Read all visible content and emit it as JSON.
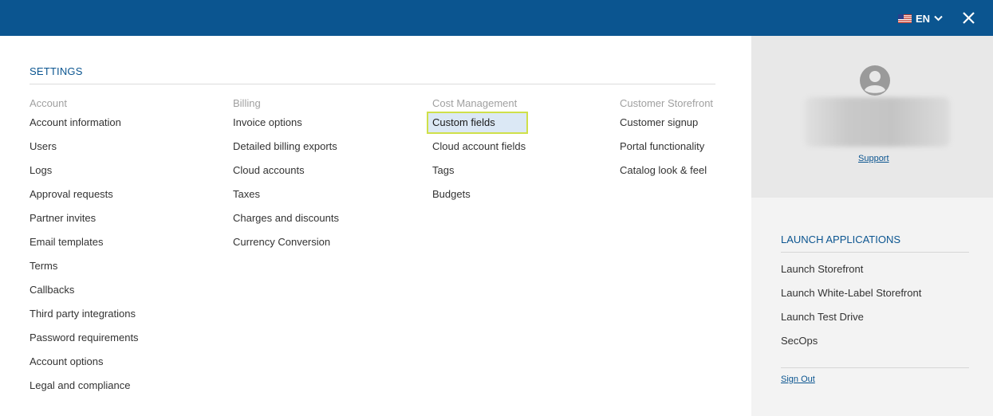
{
  "header": {
    "language_code": "EN",
    "flag_icon": "us-flag-icon",
    "close_icon": "close-icon",
    "bar_color": "#0b5590"
  },
  "settings": {
    "title": "SETTINGS",
    "columns": [
      {
        "heading": "Account",
        "items": [
          "Account information",
          "Users",
          "Logs",
          "Approval requests",
          "Partner invites",
          "Email templates",
          "Terms",
          "Callbacks",
          "Third party integrations",
          "Password requirements",
          "Account options",
          "Legal and compliance"
        ]
      },
      {
        "heading": "Billing",
        "items": [
          "Invoice options",
          "Detailed billing exports",
          "Cloud accounts",
          "Taxes",
          "Charges and discounts",
          "Currency Conversion"
        ]
      },
      {
        "heading": "Cost Management",
        "items": [
          "Custom fields",
          "Cloud account fields",
          "Tags",
          "Budgets"
        ],
        "selected": "Custom fields"
      },
      {
        "heading": "Customer Storefront",
        "items": [
          "Customer signup",
          "Portal functionality",
          "Catalog look & feel"
        ]
      }
    ]
  },
  "profile": {
    "avatar_icon": "user-avatar-icon",
    "support_link": "Support"
  },
  "launch": {
    "title": "LAUNCH APPLICATIONS",
    "items": [
      "Launch Storefront",
      "Launch White-Label Storefront",
      "Launch Test Drive",
      "SecOps"
    ]
  },
  "sign_out": "Sign Out",
  "colors": {
    "accent": "#0b5590",
    "highlight_border": "#cfe04a",
    "highlight_fill": "#dbe8f5"
  }
}
